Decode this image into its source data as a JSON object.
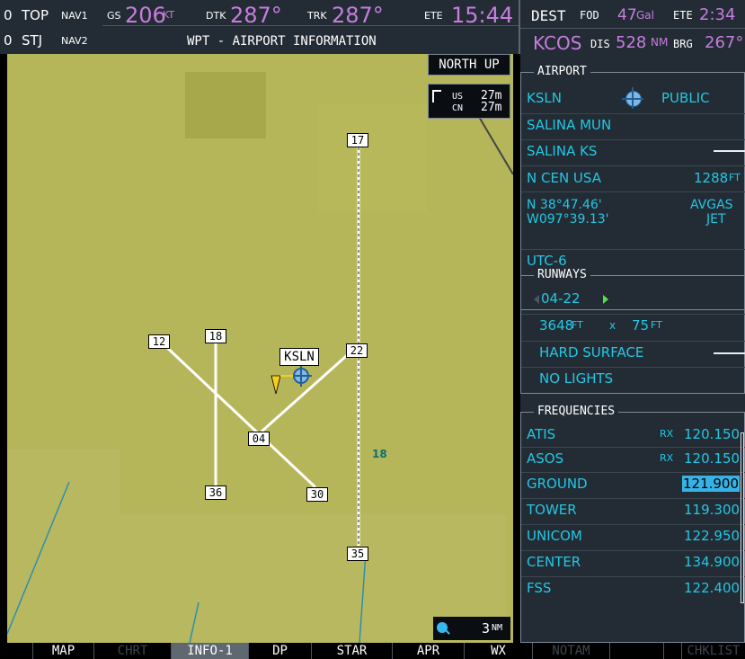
{
  "statusbar": {
    "nav1": {
      "prefix": "0",
      "ident": "TOP",
      "label": "NAV1"
    },
    "nav2": {
      "prefix": "0",
      "ident": "STJ",
      "label": "NAV2"
    },
    "gs": {
      "label": "GS",
      "value": "206",
      "unit": "KT"
    },
    "dtk": {
      "label": "DTK",
      "value": "287°"
    },
    "trk": {
      "label": "TRK",
      "value": "287°"
    },
    "ete": {
      "label": "ETE",
      "value": "15:44"
    },
    "page_title": "WPT - AIRPORT INFORMATION"
  },
  "rightbar": {
    "dest": "DEST",
    "fod_label": "FOD",
    "fod_value": "47",
    "fod_unit": "Gal",
    "ete_label": "ETE",
    "ete_value": "2:34",
    "dest_id": "KCOS",
    "dis_label": "DIS",
    "dis_value": "528",
    "dis_unit": "NM",
    "brg_label": "BRG",
    "brg_value": "267°"
  },
  "map": {
    "orientation": "NORTH UP",
    "wind": {
      "us_label": "US",
      "us_value": "27m",
      "cn_label": "CN",
      "cn_value": "27m"
    },
    "airport_label": "KSLN",
    "runway_labels": {
      "r17": "17",
      "r35": "35",
      "r12": "12",
      "r30": "30",
      "r18": "18",
      "r36": "36",
      "r04": "04",
      "r22": "22"
    },
    "map_number": "18",
    "scale": "3",
    "scale_unit": "NM"
  },
  "airport": {
    "title": "AIRPORT",
    "ident": "KSLN",
    "usage": "PUBLIC",
    "name": "SALINA MUN",
    "city": "SALINA KS",
    "region": "N CEN USA",
    "elevation": "1288",
    "elevation_unit": "FT",
    "lat": "N 38°47.46'",
    "lon": "W097°39.13'",
    "fuel_1": "AVGAS",
    "fuel_2": "JET",
    "time_zone": "UTC-6"
  },
  "runways": {
    "title": "RUNWAYS",
    "selected": "04-22",
    "length": "3648",
    "length_unit": "FT",
    "x": "x",
    "width": "75",
    "width_unit": "FT",
    "surface": "HARD SURFACE",
    "lights": "NO LIGHTS"
  },
  "frequencies": {
    "title": "FREQUENCIES",
    "items": [
      {
        "name": "ATIS",
        "rx": "RX",
        "freq": "120.150"
      },
      {
        "name": "ASOS",
        "rx": "RX",
        "freq": "120.150"
      },
      {
        "name": "GROUND",
        "rx": "",
        "freq": "121.900"
      },
      {
        "name": "TOWER",
        "rx": "",
        "freq": "119.300"
      },
      {
        "name": "UNICOM",
        "rx": "",
        "freq": "122.950"
      },
      {
        "name": "CENTER",
        "rx": "",
        "freq": "134.900"
      },
      {
        "name": "FSS",
        "rx": "",
        "freq": "122.400"
      }
    ]
  },
  "softkeys": [
    {
      "label": ""
    },
    {
      "label": "MAP"
    },
    {
      "label": "CHRT"
    },
    {
      "label": "INFO-1"
    },
    {
      "label": "DP"
    },
    {
      "label": "STAR"
    },
    {
      "label": "APR"
    },
    {
      "label": "WX"
    },
    {
      "label": "NOTAM"
    },
    {
      "label": ""
    },
    {
      "label": ""
    },
    {
      "label": "CHKLIST"
    }
  ]
}
